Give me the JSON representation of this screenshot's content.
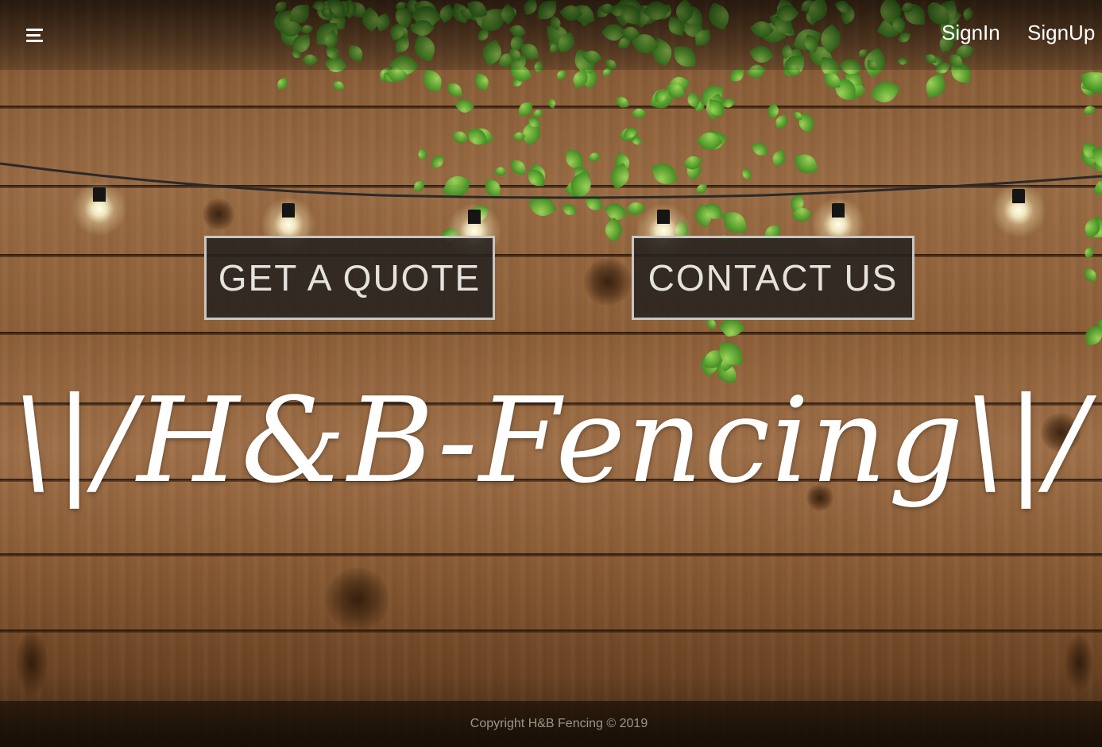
{
  "nav": {
    "menu_icon": "hamburger-menu-icon",
    "signin_label": "SignIn",
    "signup_label": "SignUp"
  },
  "hero": {
    "quote_button_label": "GET A QUOTE",
    "contact_button_label": "CONTACT US",
    "logo_text": "\\|/H&B-Fencing\\|/"
  },
  "footer": {
    "copyright": "Copyright H&B Fencing © 2019"
  },
  "colors": {
    "button_bg": "#262220",
    "button_border": "#c9c6c2",
    "button_text": "#e6e3df",
    "logo_text": "#ffffff",
    "footer_text": "#a09488"
  }
}
